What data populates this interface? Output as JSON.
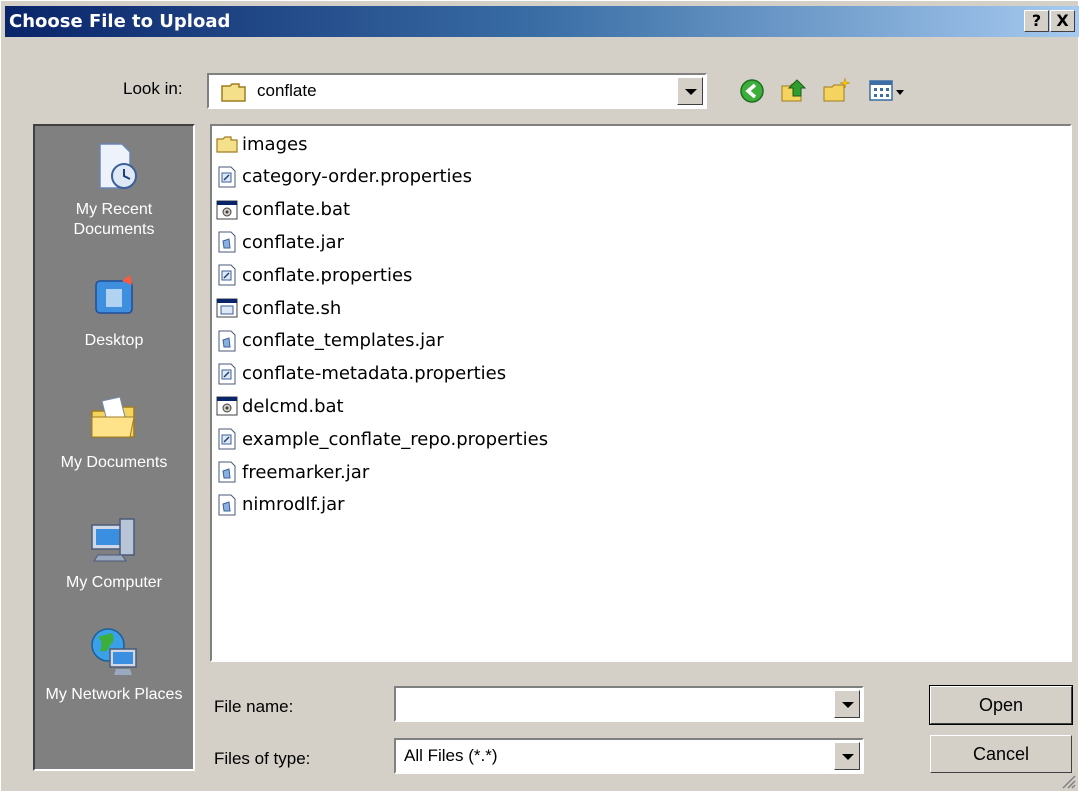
{
  "window": {
    "title": "Choose File to Upload",
    "help_label": "?",
    "close_label": "X"
  },
  "toolbar": {
    "look_in_label": "Look in:",
    "look_in_value": "conflate",
    "icons": [
      "back-icon",
      "up-folder-icon",
      "new-folder-icon",
      "view-menu-icon"
    ]
  },
  "places": [
    {
      "label": "My Recent Documents",
      "icon": "recent-documents-icon"
    },
    {
      "label": "Desktop",
      "icon": "desktop-icon"
    },
    {
      "label": "My Documents",
      "icon": "my-documents-icon"
    },
    {
      "label": "My Computer",
      "icon": "my-computer-icon"
    },
    {
      "label": "My Network Places",
      "icon": "network-places-icon"
    }
  ],
  "files": [
    {
      "name": "images",
      "type": "folder"
    },
    {
      "name": "category-order.properties",
      "type": "properties"
    },
    {
      "name": "conflate.bat",
      "type": "batch"
    },
    {
      "name": "conflate.jar",
      "type": "jar"
    },
    {
      "name": "conflate.properties",
      "type": "properties"
    },
    {
      "name": "conflate.sh",
      "type": "script"
    },
    {
      "name": "conflate_templates.jar",
      "type": "jar"
    },
    {
      "name": "conflate-metadata.properties",
      "type": "properties"
    },
    {
      "name": "delcmd.bat",
      "type": "batch"
    },
    {
      "name": "example_conflate_repo.properties",
      "type": "properties"
    },
    {
      "name": "freemarker.jar",
      "type": "jar"
    },
    {
      "name": "nimrodlf.jar",
      "type": "jar"
    }
  ],
  "form": {
    "file_name_label": "File name:",
    "file_name_value": "",
    "file_type_label": "Files of type:",
    "file_type_value": "All Files (*.*)"
  },
  "buttons": {
    "open": "Open",
    "cancel": "Cancel"
  }
}
